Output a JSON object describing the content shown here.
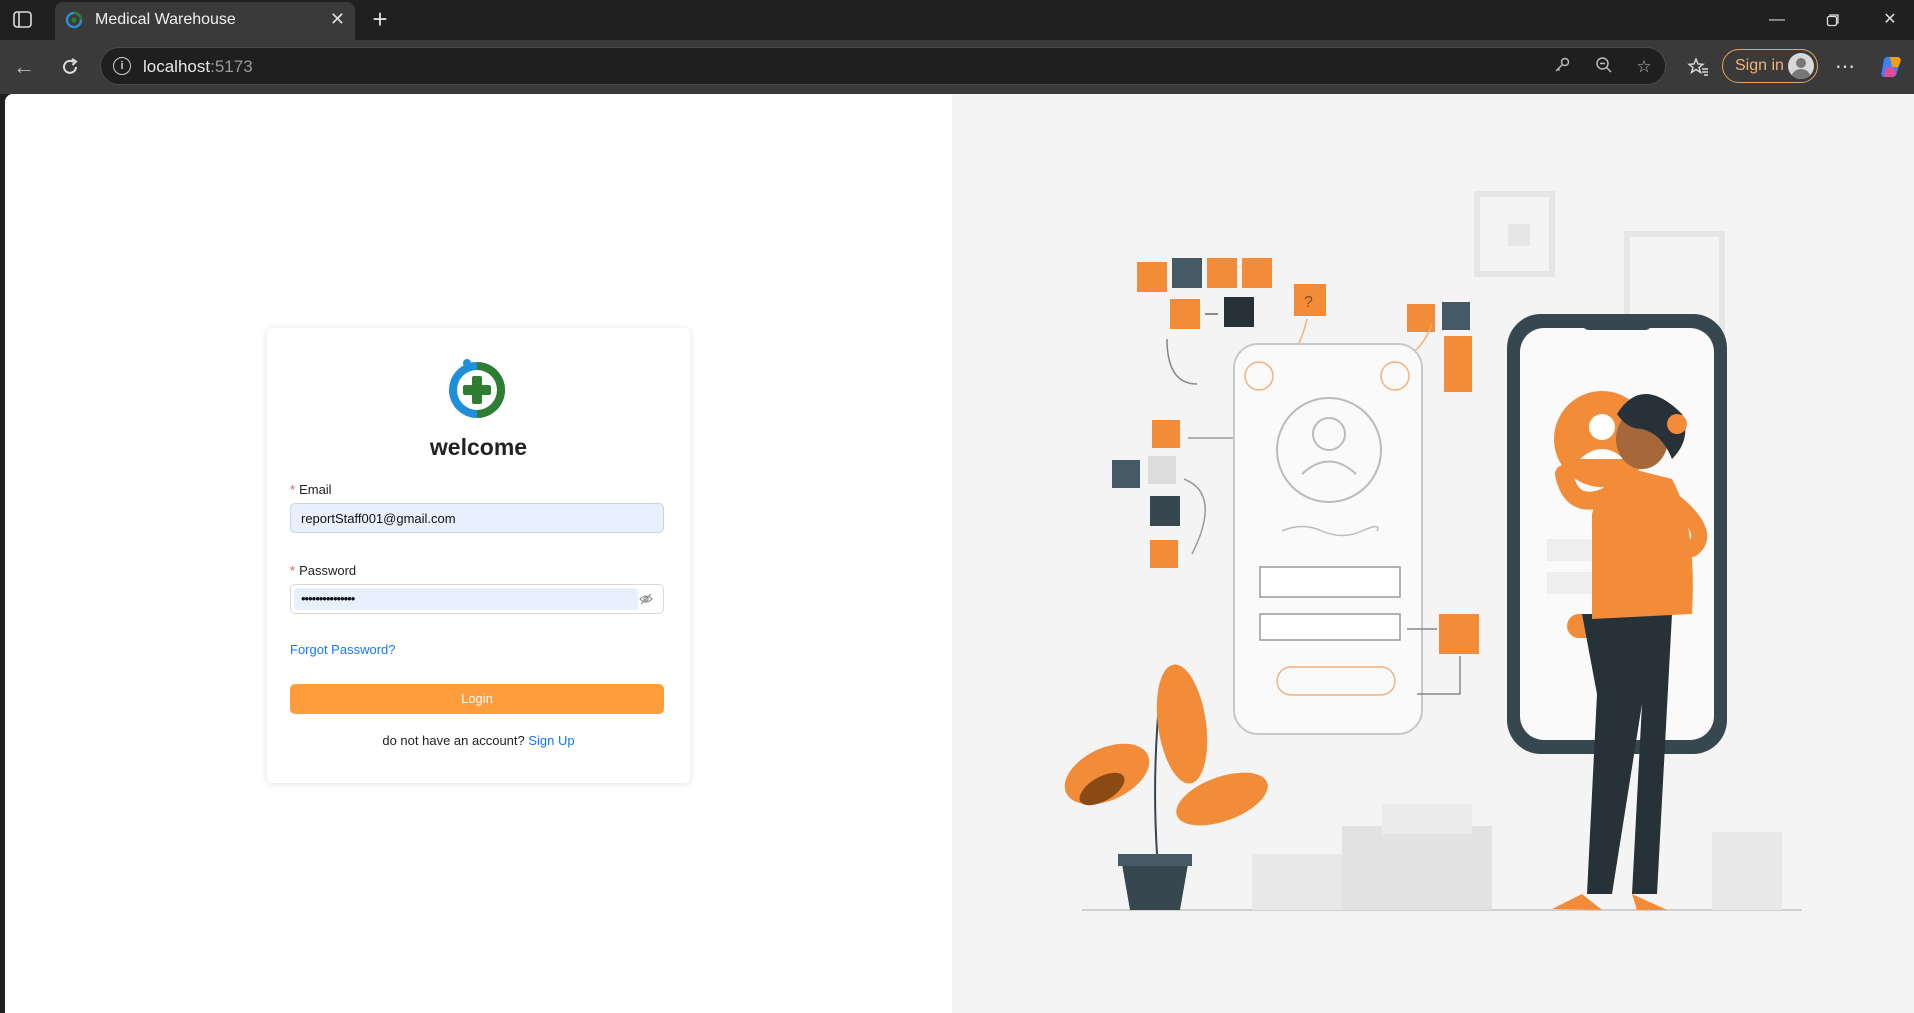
{
  "browser": {
    "tab_title": "Medical Warehouse",
    "tab_close_icon": "close-icon",
    "new_tab_symbol": "+",
    "url_host": "localhost",
    "url_port": ":5173",
    "sign_in_label": "Sign in",
    "window_controls": [
      "minimize-icon",
      "restore-icon",
      "close-icon"
    ]
  },
  "login": {
    "welcome": "welcome",
    "email_label": "Email",
    "email_value": "reportStaff001@gmail.com",
    "required_mark": "*",
    "password_label": "Password",
    "password_mask": "•••••••••••••••",
    "forgot_password": "Forgot Password?",
    "login_button": "Login",
    "no_account_text": "do not have an account? ",
    "sign_up_link": "Sign Up"
  },
  "colors": {
    "accent_orange": "#ff9c3b",
    "link_blue": "#1677ff",
    "required_red": "#ff4d4f",
    "illustration_orange": "#f28c38",
    "illustration_dark": "#37474f"
  }
}
